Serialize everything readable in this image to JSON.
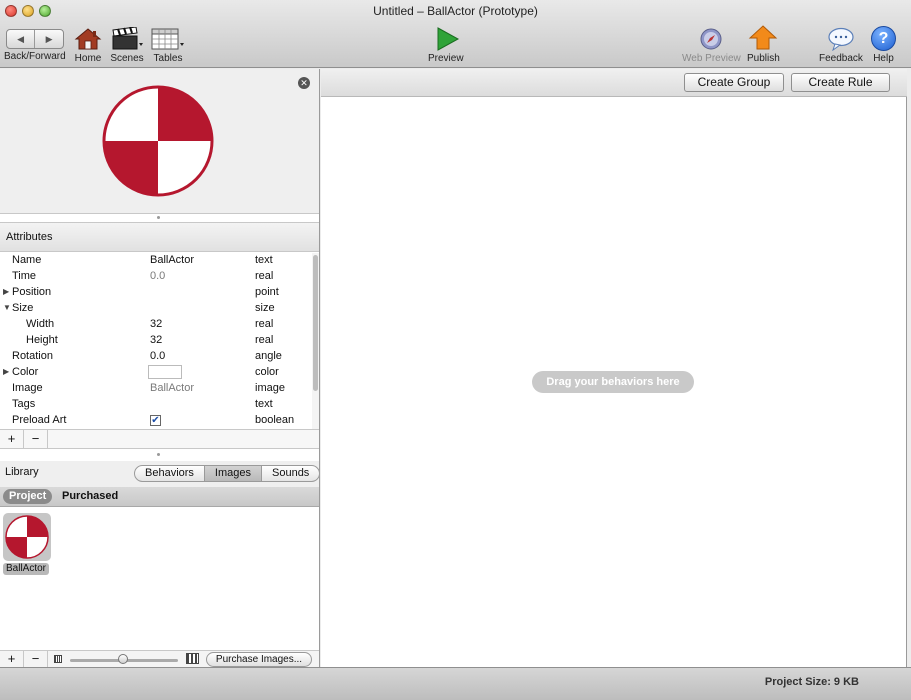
{
  "window": {
    "title": "Untitled – BallActor (Prototype)"
  },
  "toolbar": {
    "back_forward_label": "Back/Forward",
    "back_glyph": "◀",
    "forward_glyph": "▶",
    "home_label": "Home",
    "scenes_label": "Scenes",
    "tables_label": "Tables",
    "preview_label": "Preview",
    "web_preview_label": "Web Preview",
    "publish_label": "Publish",
    "feedback_label": "Feedback",
    "help_label": "Help",
    "help_glyph": "?"
  },
  "actor_preview": {
    "close_glyph": "✕",
    "colors": {
      "primary": "#b5172e",
      "secondary": "#ffffff"
    }
  },
  "attributes": {
    "header": "Attributes",
    "rows": [
      {
        "name": "Name",
        "value": "BallActor",
        "type": "text",
        "expander": ""
      },
      {
        "name": "Time",
        "value": "0.0",
        "type": "real",
        "expander": ""
      },
      {
        "name": "Position",
        "value": "",
        "type": "point",
        "expander": "▶"
      },
      {
        "name": "Size",
        "value": "",
        "type": "size",
        "expander": "▼"
      },
      {
        "name": "Width",
        "value": "32",
        "type": "real",
        "expander": ""
      },
      {
        "name": "Height",
        "value": "32",
        "type": "real",
        "expander": ""
      },
      {
        "name": "Rotation",
        "value": "0.0",
        "type": "angle",
        "expander": ""
      },
      {
        "name": "Color",
        "value": "",
        "type": "color",
        "expander": "▶"
      },
      {
        "name": "Image",
        "value": "BallActor",
        "type": "image",
        "expander": ""
      },
      {
        "name": "Tags",
        "value": "",
        "type": "text",
        "expander": ""
      },
      {
        "name": "Preload Art",
        "value": "✔",
        "type": "boolean",
        "expander": ""
      }
    ],
    "add_glyph": "+",
    "remove_glyph": "−"
  },
  "library": {
    "title": "Library",
    "tabs": [
      "Behaviors",
      "Images",
      "Sounds"
    ],
    "selected_tab": "Images",
    "subtabs": [
      "Project",
      "Purchased"
    ],
    "selected_subtab": "Project",
    "items": [
      {
        "label": "BallActor"
      }
    ],
    "add_glyph": "+",
    "remove_glyph": "−",
    "purchase_button": "Purchase Images..."
  },
  "editor": {
    "create_group": "Create Group",
    "create_rule": "Create Rule",
    "drop_hint": "Drag your behaviors here"
  },
  "status": {
    "project_size": "Project Size: 9 KB"
  }
}
